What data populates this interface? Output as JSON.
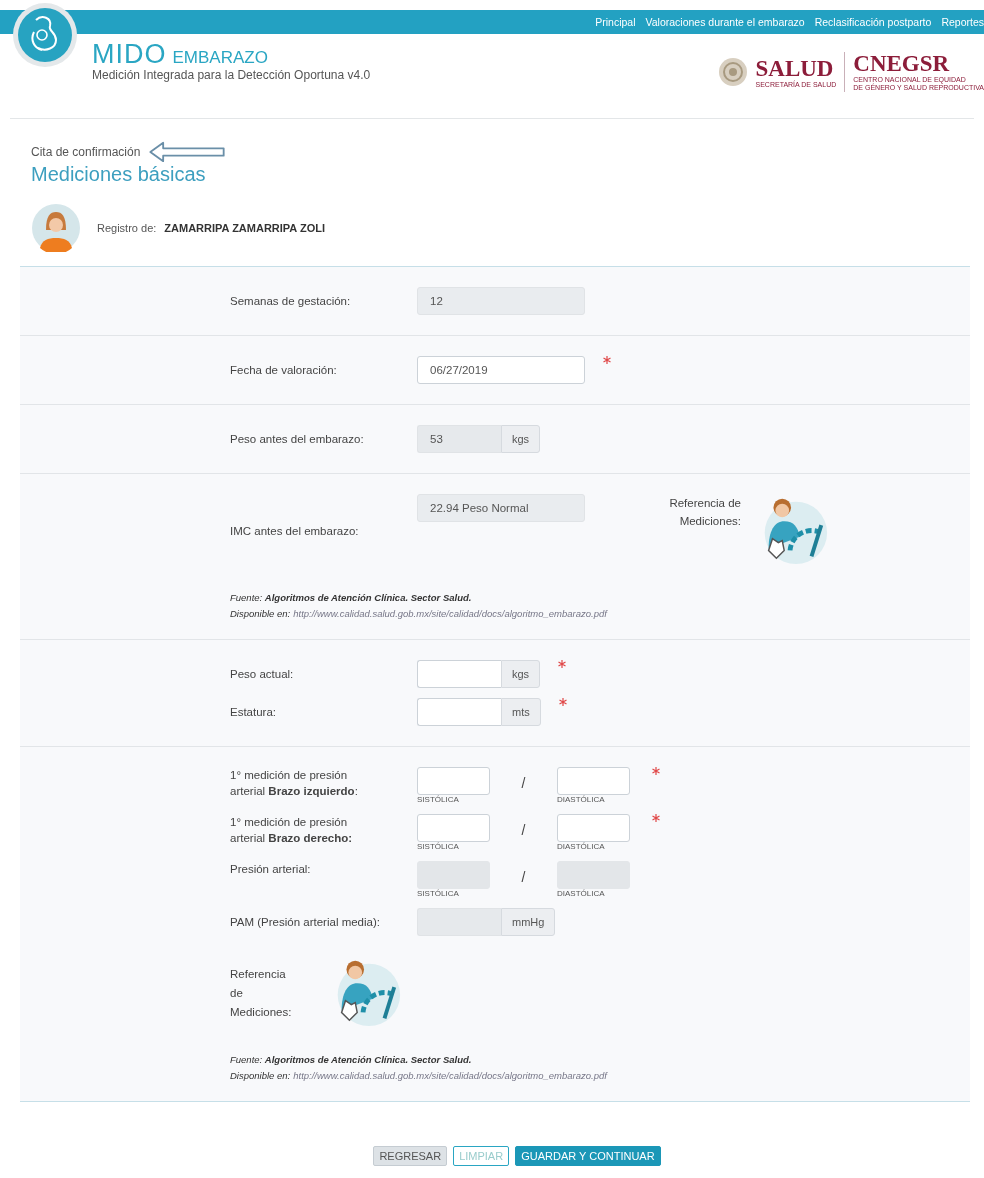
{
  "nav_links": [
    "Principal",
    "Valoraciones durante el embarazo",
    "Reclasificación postparto",
    "Reportes"
  ],
  "brand": {
    "name": "MIDO",
    "product": "EMBARAZO",
    "subtitle": "Medición Integrada para la Detección Oportuna v4.0"
  },
  "partners": {
    "salud": "SALUD",
    "salud_sub": "SECRETARÍA DE SALUD",
    "cnegsr": "CNEGSR",
    "cnegsr_sub": [
      "CENTRO NACIONAL DE EQUIDAD",
      "DE GÉNERO Y SALUD REPRODUCTIVA"
    ]
  },
  "breadcrumb": "Cita de confirmación",
  "title": "Mediciones básicas",
  "patient": {
    "label": "Registro de:",
    "name": "ZAMARRIPA ZAMARRIPA ZOLI"
  },
  "sections": [
    {
      "rows": [
        {
          "kind": "field",
          "label": "Semanas de gestación:",
          "value": "12",
          "disabled": true,
          "required": false
        }
      ]
    },
    {
      "rows": [
        {
          "kind": "field",
          "label": "Fecha de valoración:",
          "value": "06/27/2019",
          "disabled": false,
          "required": true
        }
      ]
    },
    {
      "rows": [
        {
          "kind": "field",
          "label": "Peso antes del embarazo:",
          "value": "53",
          "unit": "kgs",
          "disabled": true,
          "required": false
        }
      ]
    },
    {
      "rows": [
        {
          "kind": "field",
          "label": "IMC antes del embarazo:",
          "value": "22.94 Peso Normal",
          "disabled": true,
          "required": false,
          "reference": "Referencia de Mediciones:"
        },
        {
          "kind": "source",
          "source": "Fuente: **Algoritmos de Atención Clínica. Sector Salud.**",
          "available_label": "Disponible en:",
          "url": "http://www.calidad.salud.gob.mx/site/calidad/docs/algoritmo_embarazo.pdf"
        }
      ]
    },
    {
      "rows": [
        {
          "kind": "field",
          "label": "Peso actual:",
          "unit": "kgs",
          "disabled": false,
          "required": true
        },
        {
          "kind": "field",
          "label": "Estatura:",
          "unit": "mts",
          "disabled": false,
          "required": true
        }
      ]
    },
    {
      "rows": [
        {
          "kind": "pressure",
          "label": "1° medición de presión arterial **Brazo izquierdo**:",
          "systolic": "SISTÓLICA",
          "separator": "/",
          "diastolic": "DIASTÓLICA",
          "disabled": false,
          "required": true
        },
        {
          "kind": "pressure",
          "label": "1° medición de presión arterial **Brazo derecho:**",
          "systolic": "SISTÓLICA",
          "separator": "/",
          "diastolic": "DIASTÓLICA",
          "disabled": false,
          "required": true
        },
        {
          "kind": "pressure",
          "label": "Presión arterial:",
          "systolic": "SISTÓLICA",
          "separator": "/",
          "diastolic": "DIASTÓLICA",
          "disabled": true,
          "required": false
        },
        {
          "kind": "field",
          "label": "PAM (Presión arterial media):",
          "unit": "mmHg",
          "disabled": true,
          "required": false
        },
        {
          "kind": "reference",
          "label": "Referencia de Mediciones:"
        },
        {
          "kind": "source",
          "source": "Fuente: **Algoritmos de Atención Clínica. Sector Salud.**",
          "available_label": "Disponible en:",
          "url": "http://www.calidad.salud.gob.mx/site/calidad/docs/algoritmo_embarazo.pdf"
        }
      ]
    }
  ],
  "buttons": [
    {
      "label": "REGRESAR",
      "kind": "secondary"
    },
    {
      "label": "LIMPIAR",
      "kind": "outline"
    },
    {
      "label": "GUARDAR Y CONTINUAR",
      "kind": "primary"
    }
  ]
}
